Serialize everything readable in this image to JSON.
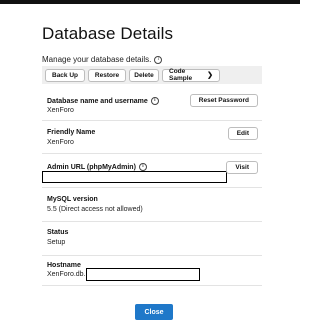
{
  "dialog": {
    "title": "Database Details",
    "subtitle": "Manage your database details."
  },
  "toolbar": {
    "back_up": "Back Up",
    "restore": "Restore",
    "delete": "Delete",
    "code_sample": "Code Sample"
  },
  "details": {
    "db_name": {
      "label": "Database name and username",
      "value": "XenForo",
      "button": "Reset Password"
    },
    "friendly_name": {
      "label": "Friendly Name",
      "value": "XenForo",
      "button": "Edit"
    },
    "admin_url": {
      "label": "Admin URL (phpMyAdmin)",
      "button": "Visit"
    },
    "mysql_version": {
      "label": "MySQL version",
      "value": "5.5 (Direct access not allowed)"
    },
    "status": {
      "label": "Status",
      "value": "Setup"
    },
    "hostname": {
      "label": "Hostname",
      "value": "XenForo.db."
    }
  },
  "footer": {
    "close": "Close"
  },
  "colors": {
    "accent": "#1f78c9",
    "toolbar_bg": "#efefef"
  },
  "icons": {
    "info": "info-icon",
    "dropdown": "chevron-down-icon"
  }
}
